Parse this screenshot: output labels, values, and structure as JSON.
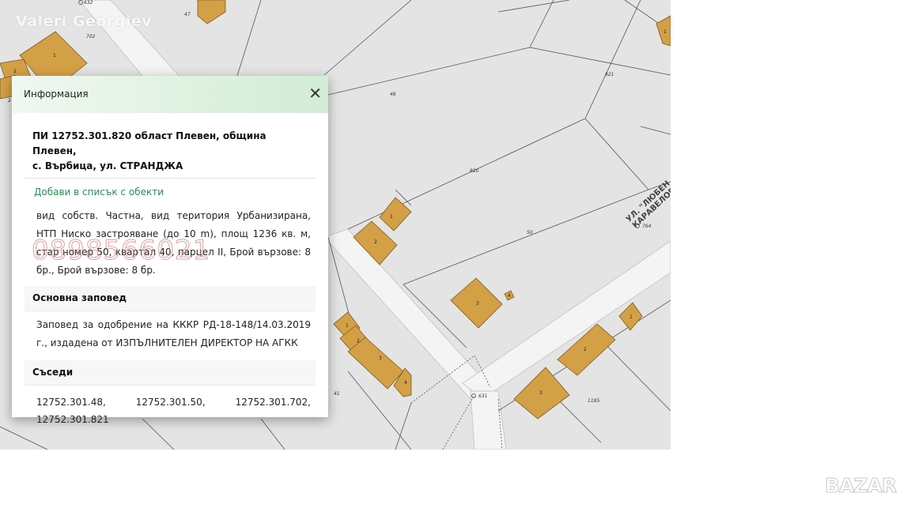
{
  "watermark": "Valeri Georgiev",
  "corner_logo": "BAZAR",
  "map": {
    "street_label_line1": "УЛ. \"ЛЮБЕН",
    "street_label_line2": "КАРАВЕЛОВ",
    "parcel_numbers": [
      "702",
      "47",
      "46",
      "821",
      "820",
      "50",
      "764",
      "631",
      "41",
      "1185",
      "632"
    ],
    "building_numbers": [
      "1",
      "2",
      "2",
      "1",
      "2",
      "3",
      "4",
      "1",
      "2",
      "3",
      "4",
      "1",
      "2",
      "3",
      "1"
    ]
  },
  "popup": {
    "title": "Информация",
    "close_symbol": "✕",
    "parcel_line1": "ПИ 12752.301.820 област Плевен, община Плевен,",
    "parcel_line2": "с. Върбица, ул. СТРАНДЖА",
    "add_link": "Добави в списък с обекти",
    "details": "вид собств. Частна, вид територия Урбанизирана, НТП Ниско застрояване (до 10 m), площ 1236 кв. м, стар номер 50, квартал 40, парцел II, Брой вързове: 8 бр., Брой вързове: 8 бр.",
    "phone_watermark": "0898566021",
    "order_heading": "Основна заповед",
    "order_text": "Заповед за одобрение на КККР РД-18-148/14.03.2019 г., издадена от ИЗПЪЛНИТЕЛЕН ДИРЕКТОР НА АГКК",
    "neighbors_heading": "Съседи",
    "neighbors": [
      "12752.301.48,",
      "12752.301.50,",
      "12752.301.702,",
      "12752.301.821"
    ]
  },
  "colors": {
    "building_fill": "#d4a046",
    "map_bg": "#e4e4e4",
    "road_fill": "#f4f4f4",
    "link_green": "#2e8b57",
    "header_green": "#d2ecd5"
  }
}
